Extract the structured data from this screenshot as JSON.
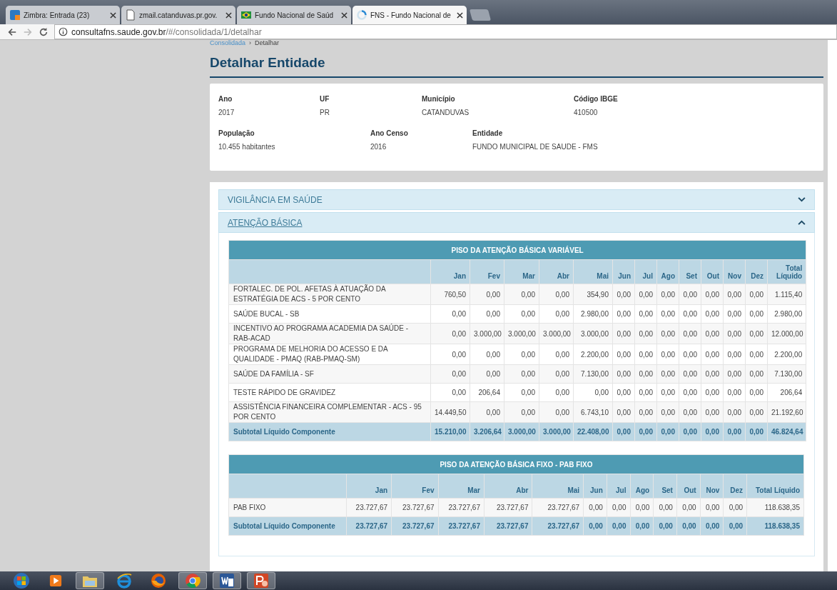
{
  "browser": {
    "tabs": [
      {
        "title": "Zimbra: Entrada (23)",
        "selected": false
      },
      {
        "title": "zmail.catanduvas.pr.gov.",
        "selected": false
      },
      {
        "title": "Fundo Nacional de Saúd",
        "selected": false
      },
      {
        "title": "FNS - Fundo Nacional de",
        "selected": true
      }
    ],
    "address": {
      "host": "consultafns.saude.gov.br",
      "path": "/#/consolidada/1/detalhar"
    }
  },
  "breadcrumb": {
    "link": "Consolidada",
    "separator": "›",
    "current": "Detalhar"
  },
  "page_title": "Detalhar Entidade",
  "entity_fields": [
    [
      {
        "label": "Ano",
        "value": "2017"
      },
      {
        "label": "UF",
        "value": "PR"
      },
      {
        "label": "Município",
        "value": "CATANDUVAS"
      },
      {
        "label": "Código IBGE",
        "value": "410500"
      }
    ],
    [
      {
        "label": "População",
        "value": "10.455 habitantes"
      },
      {
        "label": "Ano Censo",
        "value": "2016"
      },
      {
        "label": "Entidade",
        "value": "FUNDO MUNICIPAL DE SAUDE - FMS"
      }
    ]
  ],
  "accordion": [
    {
      "title": "VIGILÂNCIA EM SAÚDE",
      "expanded": false
    },
    {
      "title": "ATENÇÃO BÁSICA",
      "expanded": true,
      "tables": [
        {
          "title": "PISO DA ATENÇÃO BÁSICA VARIÁVEL",
          "columns": [
            "",
            "Jan",
            "Fev",
            "Mar",
            "Abr",
            "Mai",
            "Jun",
            "Jul",
            "Ago",
            "Set",
            "Out",
            "Nov",
            "Dez",
            "Total Líquido"
          ],
          "rows": [
            {
              "label": "FORTALEC. DE POL. AFETAS À ATUAÇÃO DA ESTRATÉGIA DE ACS - 5 POR CENTO",
              "values": [
                "760,50",
                "0,00",
                "0,00",
                "0,00",
                "354,90",
                "0,00",
                "0,00",
                "0,00",
                "0,00",
                "0,00",
                "0,00",
                "0,00",
                "1.115,40"
              ]
            },
            {
              "label": "SAÚDE BUCAL - SB",
              "values": [
                "0,00",
                "0,00",
                "0,00",
                "0,00",
                "2.980,00",
                "0,00",
                "0,00",
                "0,00",
                "0,00",
                "0,00",
                "0,00",
                "0,00",
                "2.980,00"
              ]
            },
            {
              "label": "INCENTIVO AO PROGRAMA ACADEMIA DA SAÚDE - RAB-ACAD",
              "values": [
                "0,00",
                "3.000,00",
                "3.000,00",
                "3.000,00",
                "3.000,00",
                "0,00",
                "0,00",
                "0,00",
                "0,00",
                "0,00",
                "0,00",
                "0,00",
                "12.000,00"
              ]
            },
            {
              "label": "PROGRAMA DE MELHORIA DO ACESSO E DA QUALIDADE - PMAQ (RAB-PMAQ-SM)",
              "values": [
                "0,00",
                "0,00",
                "0,00",
                "0,00",
                "2.200,00",
                "0,00",
                "0,00",
                "0,00",
                "0,00",
                "0,00",
                "0,00",
                "0,00",
                "2.200,00"
              ]
            },
            {
              "label": "SAÚDE DA FAMÍLIA - SF",
              "values": [
                "0,00",
                "0,00",
                "0,00",
                "0,00",
                "7.130,00",
                "0,00",
                "0,00",
                "0,00",
                "0,00",
                "0,00",
                "0,00",
                "0,00",
                "7.130,00"
              ]
            },
            {
              "label": "TESTE RÁPIDO DE GRAVIDEZ",
              "values": [
                "0,00",
                "206,64",
                "0,00",
                "0,00",
                "0,00",
                "0,00",
                "0,00",
                "0,00",
                "0,00",
                "0,00",
                "0,00",
                "0,00",
                "206,64"
              ]
            },
            {
              "label": "ASSISTÊNCIA FINANCEIRA COMPLEMENTAR - ACS - 95 POR CENTO",
              "values": [
                "14.449,50",
                "0,00",
                "0,00",
                "0,00",
                "6.743,10",
                "0,00",
                "0,00",
                "0,00",
                "0,00",
                "0,00",
                "0,00",
                "0,00",
                "21.192,60"
              ]
            }
          ],
          "subtotal": {
            "label": "Subtotal Líquido Componente",
            "values": [
              "15.210,00",
              "3.206,64",
              "3.000,00",
              "3.000,00",
              "22.408,00",
              "0,00",
              "0,00",
              "0,00",
              "0,00",
              "0,00",
              "0,00",
              "0,00",
              "46.824,64"
            ]
          }
        },
        {
          "title": "PISO DA ATENÇÃO BÁSICA FIXO - PAB FIXO",
          "columns": [
            "",
            "Jan",
            "Fev",
            "Mar",
            "Abr",
            "Mai",
            "Jun",
            "Jul",
            "Ago",
            "Set",
            "Out",
            "Nov",
            "Dez",
            "Total Líquido"
          ],
          "rows": [
            {
              "label": "PAB FIXO",
              "values": [
                "23.727,67",
                "23.727,67",
                "23.727,67",
                "23.727,67",
                "23.727,67",
                "0,00",
                "0,00",
                "0,00",
                "0,00",
                "0,00",
                "0,00",
                "0,00",
                "118.638,35"
              ]
            }
          ],
          "subtotal": {
            "label": "Subtotal Líquido Componente",
            "values": [
              "23.727,67",
              "23.727,67",
              "23.727,67",
              "23.727,67",
              "23.727,67",
              "0,00",
              "0,00",
              "0,00",
              "0,00",
              "0,00",
              "0,00",
              "0,00",
              "118.638,35"
            ]
          }
        }
      ]
    }
  ],
  "taskbar": [
    {
      "selected": false
    },
    {
      "selected": false
    },
    {
      "selected": true
    },
    {
      "selected": false
    },
    {
      "selected": false
    },
    {
      "selected": true
    },
    {
      "selected": true
    },
    {
      "selected": true
    }
  ]
}
